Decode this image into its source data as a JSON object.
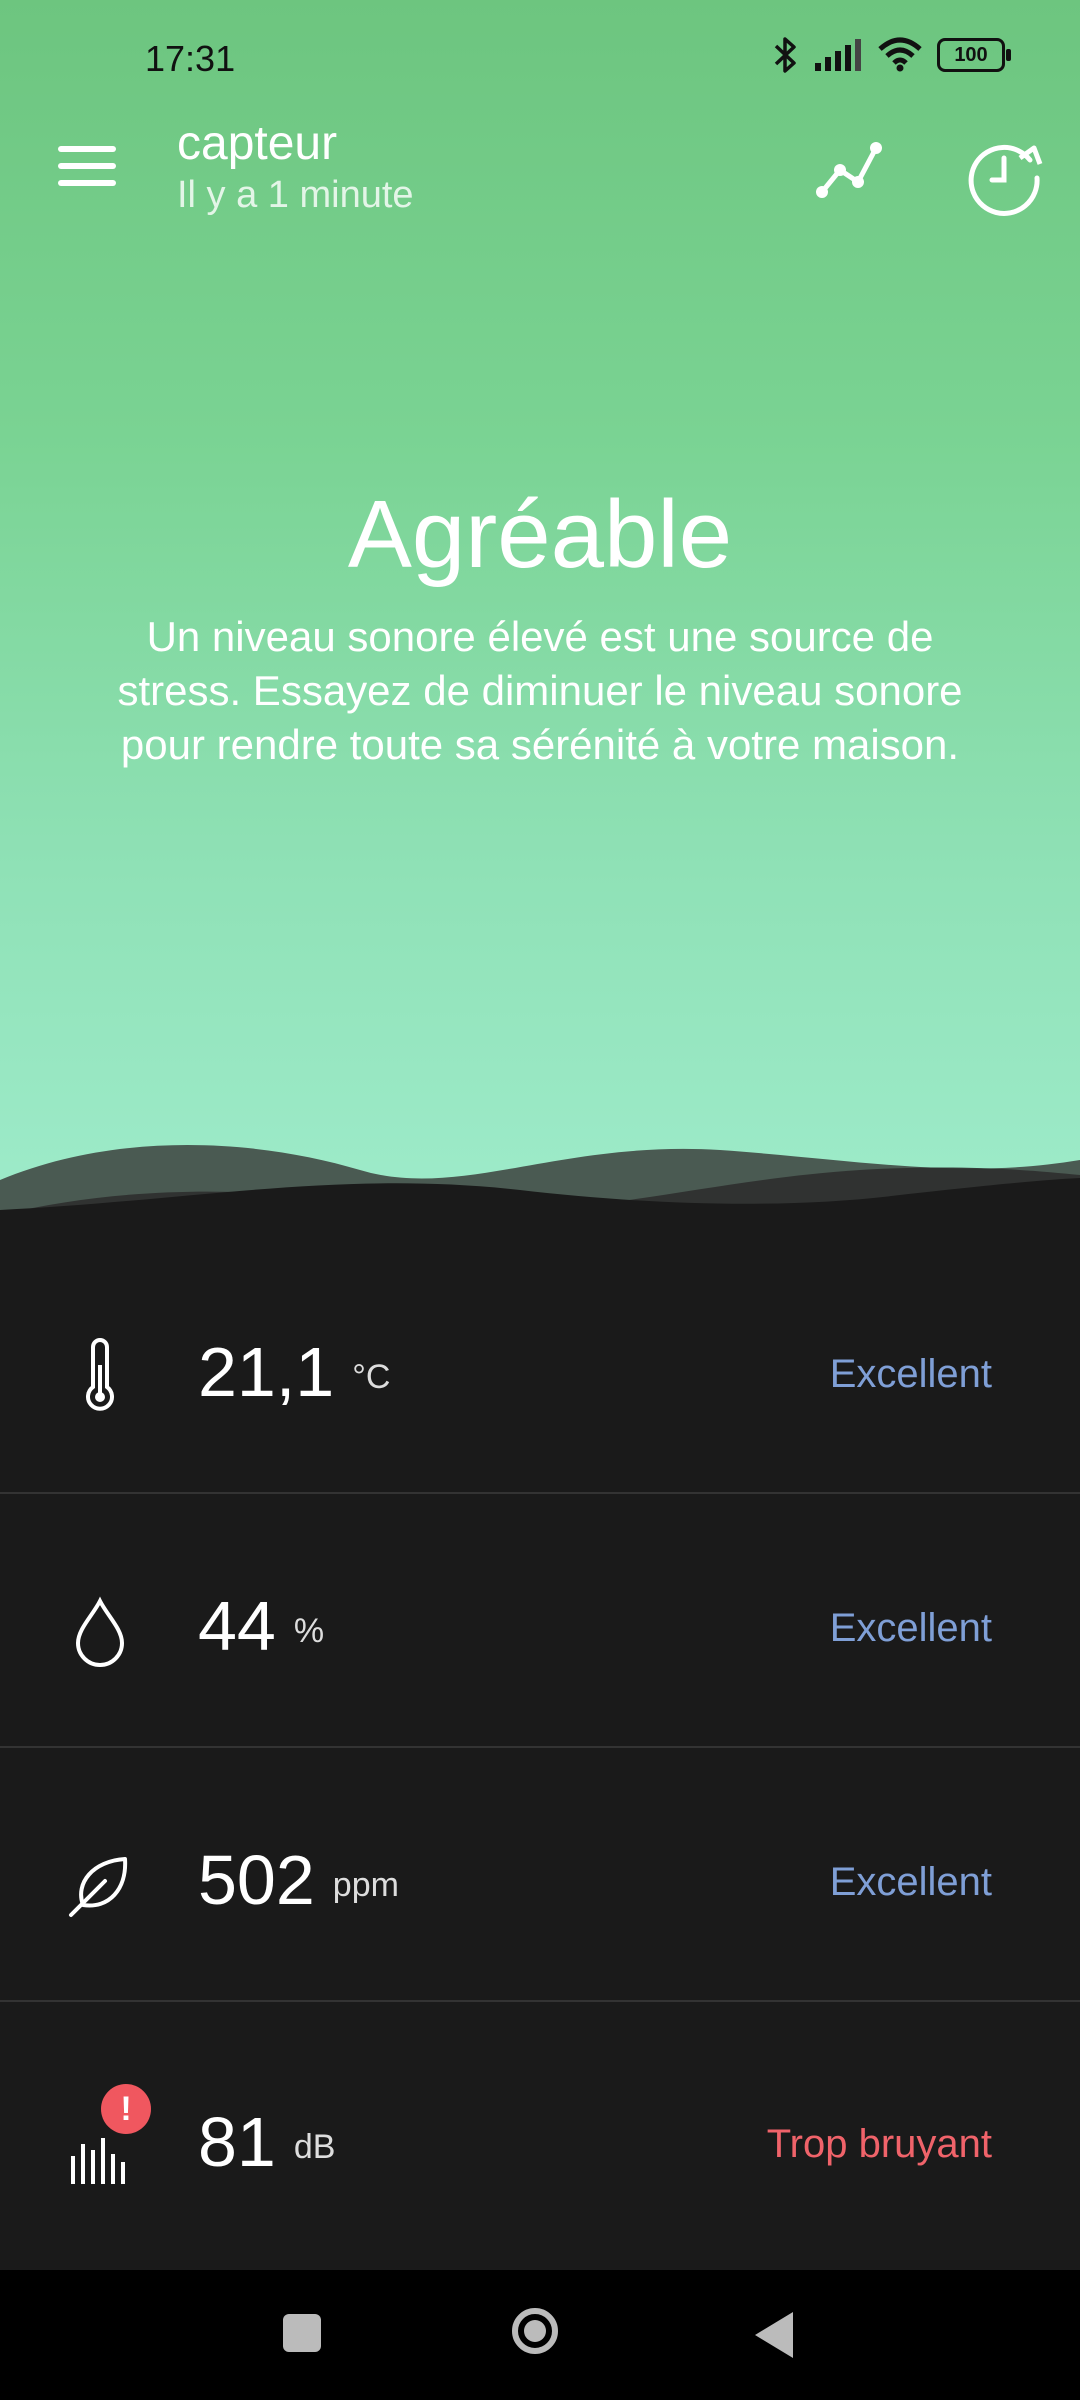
{
  "status_bar": {
    "time": "17:31",
    "battery": "100"
  },
  "header": {
    "title": "capteur",
    "subtitle": "Il y a 1 minute"
  },
  "hero": {
    "headline": "Agréable",
    "description": "Un niveau sonore élevé est une source de stress. Essayez de diminuer le niveau sonore pour rendre toute sa sérénité à votre maison."
  },
  "metrics": [
    {
      "icon": "thermometer-icon",
      "value": "21,1",
      "unit": "°C",
      "status": "Excellent",
      "status_color": "#7f9fd6"
    },
    {
      "icon": "droplet-icon",
      "value": "44",
      "unit": "%",
      "status": "Excellent",
      "status_color": "#7f9fd6"
    },
    {
      "icon": "leaf-icon",
      "value": "502",
      "unit": "ppm",
      "status": "Excellent",
      "status_color": "#7f9fd6"
    },
    {
      "icon": "sound-level-icon",
      "value": "81",
      "unit": "dB",
      "status": "Trop bruyant",
      "status_color": "#f0636a",
      "alert": "!"
    }
  ],
  "colors": {
    "hero_top": "#6dc57f",
    "hero_bottom": "#9feccc",
    "panel": "#1a1a1a",
    "alert": "#f0575f"
  }
}
